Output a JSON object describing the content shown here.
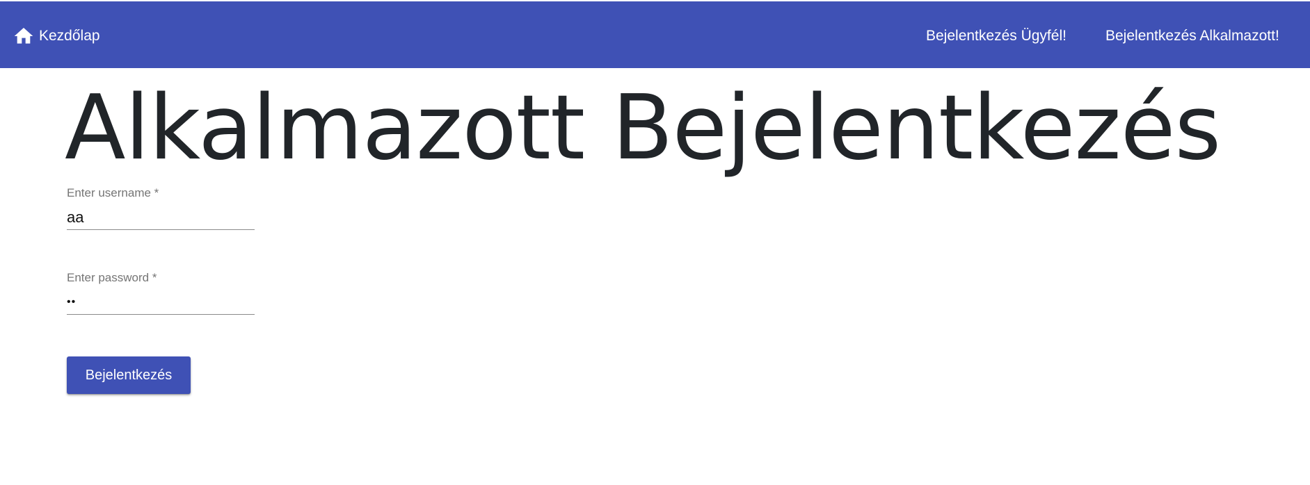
{
  "colors": {
    "primary": "#3f51b5",
    "toolbar_text": "#ffffff",
    "title_text": "#212529",
    "label_text": "#757575"
  },
  "toolbar": {
    "home_icon": "home-icon",
    "home_label": "Kezdőlap",
    "customer_login_label": "Bejelentkezés Ügyfél!",
    "employee_login_label": "Bejelentkezés Alkalmazott!"
  },
  "main": {
    "title": "Alkalmazott Bejelentkezés",
    "username": {
      "label": "Enter username *",
      "value": "aa"
    },
    "password": {
      "label": "Enter password *",
      "value": "aa"
    },
    "submit_label": "Bejelentkezés"
  }
}
